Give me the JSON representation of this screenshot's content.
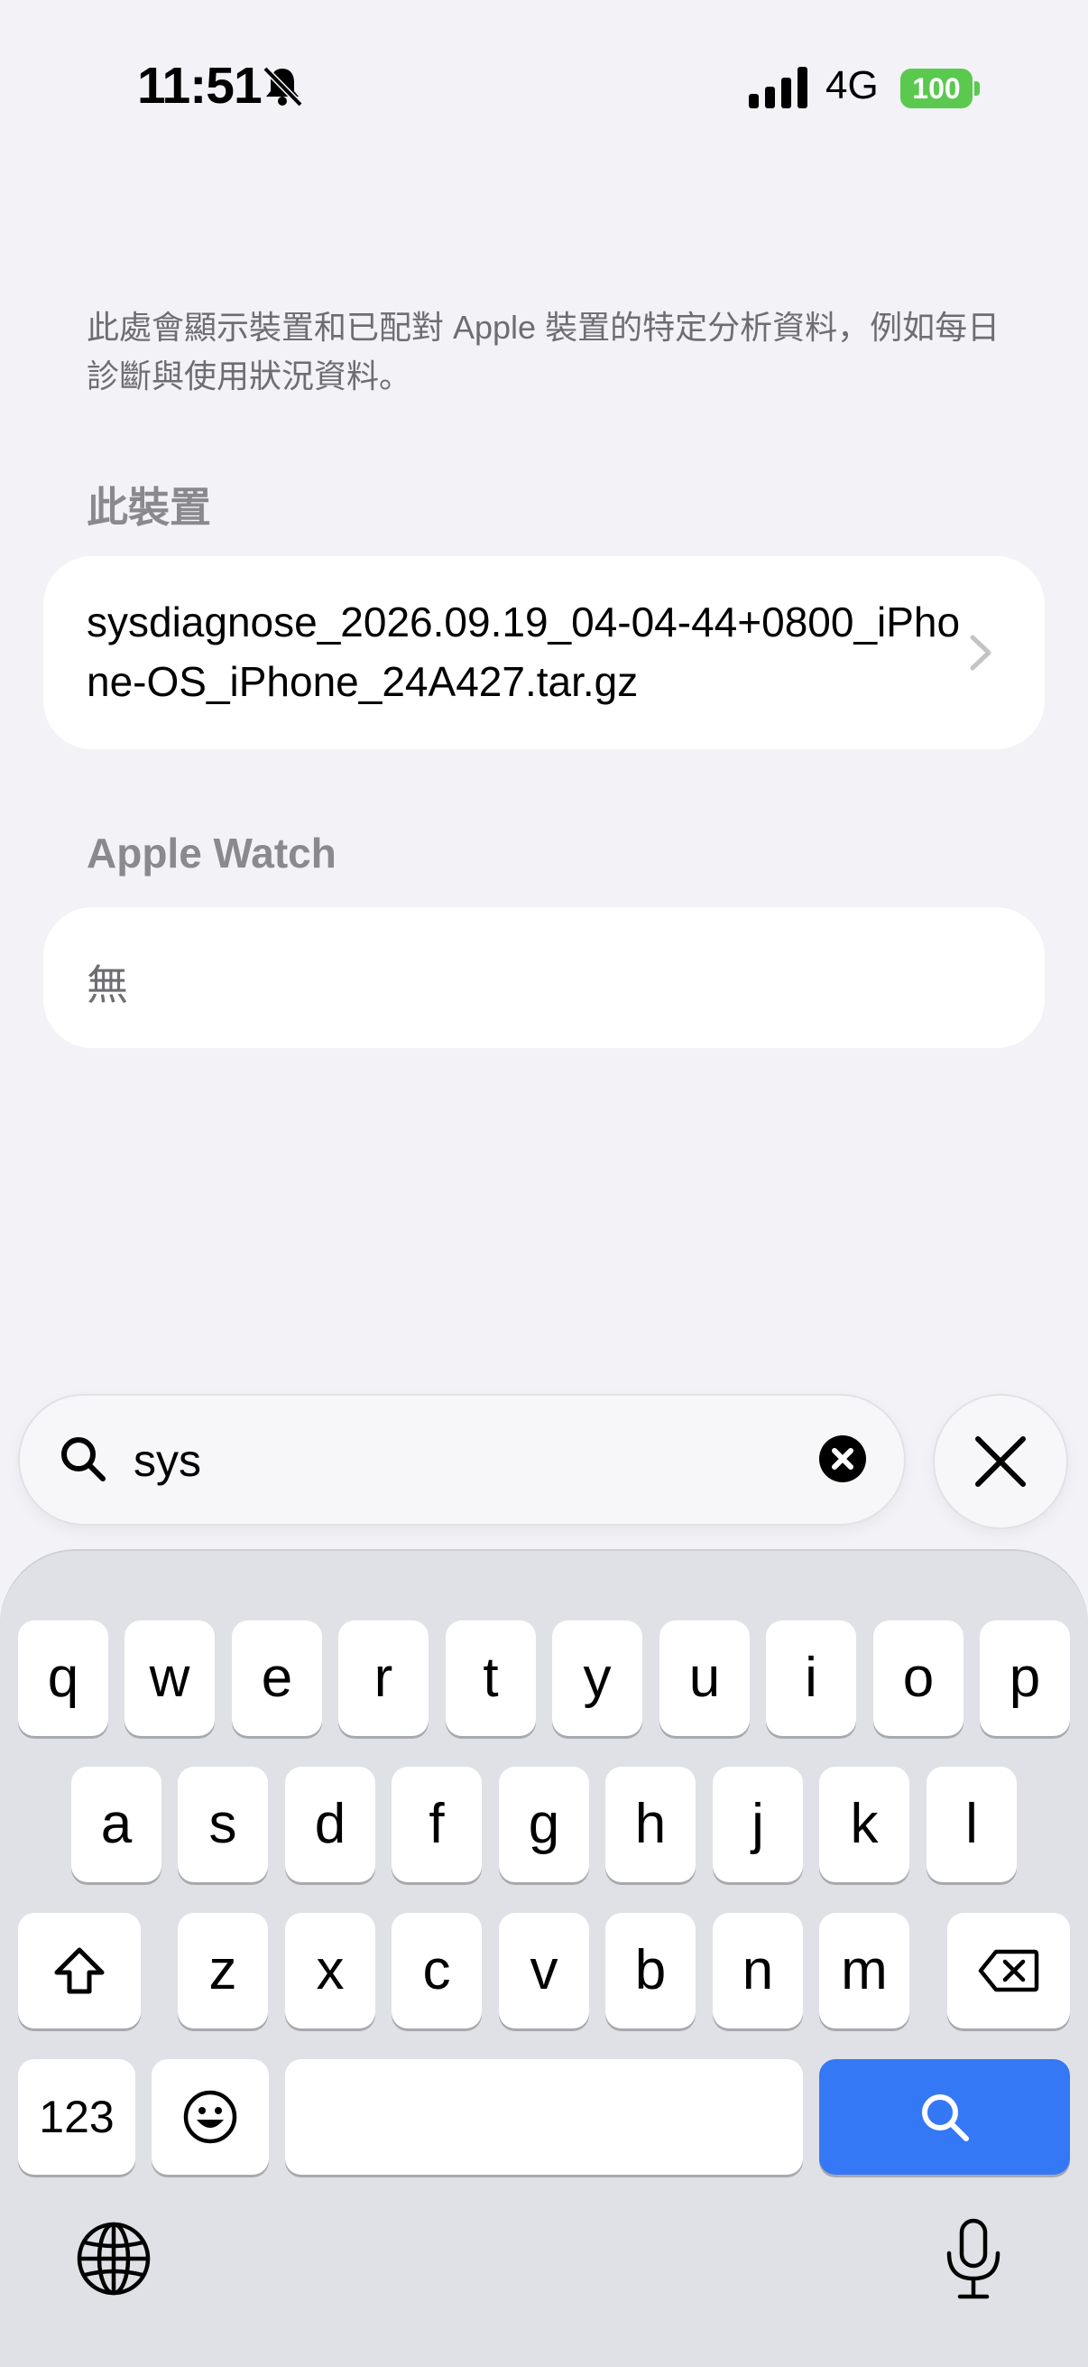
{
  "status_bar": {
    "time": "11:51",
    "network": "4G",
    "battery": "100"
  },
  "content": {
    "description": "此處會顯示裝置和已配對 Apple 裝置的特定分析資料，例如每日診斷與使用狀況資料。",
    "sections": [
      {
        "title": "此裝置",
        "items": [
          "sysdiagnose_2026.09.19_04-04-44+0800_iPhone-OS_iPhone_24A427.tar.gz"
        ]
      },
      {
        "title": "Apple Watch",
        "empty_text": "無"
      }
    ]
  },
  "search": {
    "value": "sys"
  },
  "keyboard": {
    "row1": [
      "q",
      "w",
      "e",
      "r",
      "t",
      "y",
      "u",
      "i",
      "o",
      "p"
    ],
    "row2": [
      "a",
      "s",
      "d",
      "f",
      "g",
      "h",
      "j",
      "k",
      "l"
    ],
    "row3": [
      "z",
      "x",
      "c",
      "v",
      "b",
      "n",
      "m"
    ],
    "numbers_label": "123"
  },
  "colors": {
    "background": "#f2f2f7",
    "accent": "#3478f6",
    "battery": "#5ac94e"
  }
}
